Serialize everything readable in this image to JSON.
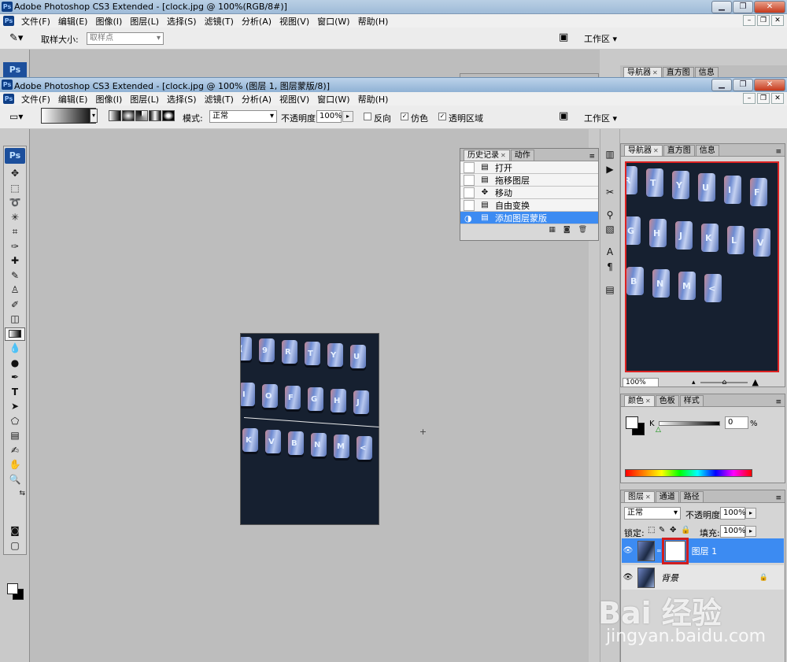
{
  "back_window": {
    "title": "Adobe Photoshop CS3 Extended - [clock.jpg @ 100%(RGB/8#)]",
    "menu": [
      "文件(F)",
      "编辑(E)",
      "图像(I)",
      "图层(L)",
      "选择(S)",
      "滤镜(T)",
      "分析(A)",
      "视图(V)",
      "窗口(W)",
      "帮助(H)"
    ],
    "options": {
      "sample_size_label": "取样大小:",
      "sample_size_value": "取样点",
      "workspace_label": "工作区"
    }
  },
  "front_window": {
    "title": "Adobe Photoshop CS3 Extended - [clock.jpg @ 100% (图层 1, 图层蒙版/8)]",
    "menu": [
      "文件(F)",
      "编辑(E)",
      "图像(I)",
      "图层(L)",
      "选择(S)",
      "滤镜(T)",
      "分析(A)",
      "视图(V)",
      "窗口(W)",
      "帮助(H)"
    ],
    "options": {
      "mode_label": "模式:",
      "mode_value": "正常",
      "opacity_label": "不透明度:",
      "opacity_value": "100%",
      "reverse_label": "反向",
      "dither_label": "仿色",
      "transparency_label": "透明区域",
      "workspace_label": "工作区"
    }
  },
  "toolbox": {
    "logo": "Ps"
  },
  "history_panel": {
    "tabs": [
      "历史记录",
      "动作"
    ],
    "items": [
      {
        "label": "打开"
      },
      {
        "label": "拖移图层"
      },
      {
        "label": "移动"
      },
      {
        "label": "自由变换"
      },
      {
        "label": "添加图层蒙版"
      }
    ]
  },
  "navigator_panel": {
    "tabs": [
      "导航器",
      "直方图",
      "信息"
    ],
    "zoom": "100%"
  },
  "color_panel": {
    "tabs": [
      "颜色",
      "色板",
      "样式"
    ],
    "channel": "K",
    "value": "0",
    "unit": "%"
  },
  "layers_panel": {
    "tabs": [
      "图层",
      "通道",
      "路径"
    ],
    "blend_mode": "正常",
    "opacity_label": "不透明度:",
    "opacity_value": "100%",
    "lock_label": "锁定:",
    "fill_label": "填充:",
    "fill_value": "100%",
    "layers": [
      {
        "name": "图层 1"
      },
      {
        "name": "背景"
      }
    ]
  },
  "document_keys": [
    "(",
    "9",
    "R",
    "T",
    "Y",
    "U",
    "I",
    "O",
    "F",
    "G",
    "H",
    "J",
    "K",
    "V",
    "B",
    "N",
    "M",
    "<"
  ],
  "navigator_keys": [
    "R",
    "T",
    "Y",
    "U",
    "I",
    "F",
    "G",
    "H",
    "J",
    "K",
    "L",
    "V",
    "B",
    "N",
    "M",
    "<"
  ],
  "watermark": {
    "brand": "Bai 经验",
    "url": "jingyan.baidu.com"
  }
}
